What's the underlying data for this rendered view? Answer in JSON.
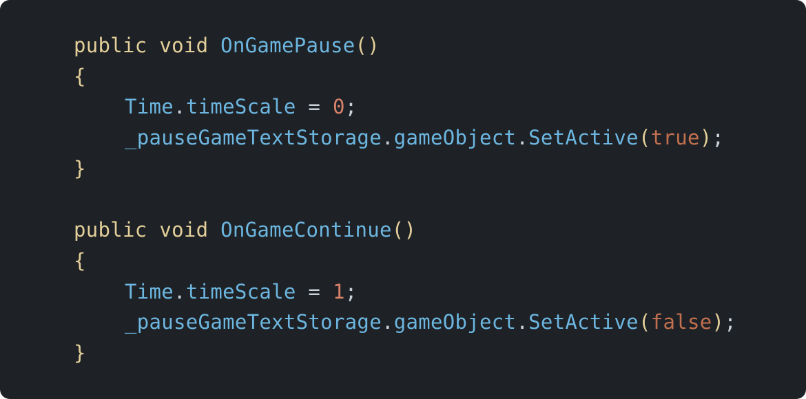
{
  "colors": {
    "background": "#1e2125",
    "keyword": "#e3cf9a",
    "identifier": "#6cb6e0",
    "number": "#d9826a",
    "literal": "#c2704f",
    "punctuation": "#c9d1d9"
  },
  "methods": [
    {
      "modifier": "public",
      "return_type": "void",
      "name": "OnGamePause",
      "parens": "()",
      "open_brace": "{",
      "close_brace": "}",
      "statements": [
        {
          "object": "Time",
          "dot1": ".",
          "member": "timeScale",
          "op": " = ",
          "value": "0",
          "end": ";"
        },
        {
          "object": "_pauseGameTextStorage",
          "dot1": ".",
          "member": "gameObject",
          "dot2": ".",
          "call": "SetActive",
          "open_paren": "(",
          "arg": "true",
          "close_paren": ")",
          "end": ";"
        }
      ]
    },
    {
      "modifier": "public",
      "return_type": "void",
      "name": "OnGameContinue",
      "parens": "()",
      "open_brace": "{",
      "close_brace": "}",
      "statements": [
        {
          "object": "Time",
          "dot1": ".",
          "member": "timeScale",
          "op": " = ",
          "value": "1",
          "end": ";"
        },
        {
          "object": "_pauseGameTextStorage",
          "dot1": ".",
          "member": "gameObject",
          "dot2": ".",
          "call": "SetActive",
          "open_paren": "(",
          "arg": "false",
          "close_paren": ")",
          "end": ";"
        }
      ]
    }
  ]
}
